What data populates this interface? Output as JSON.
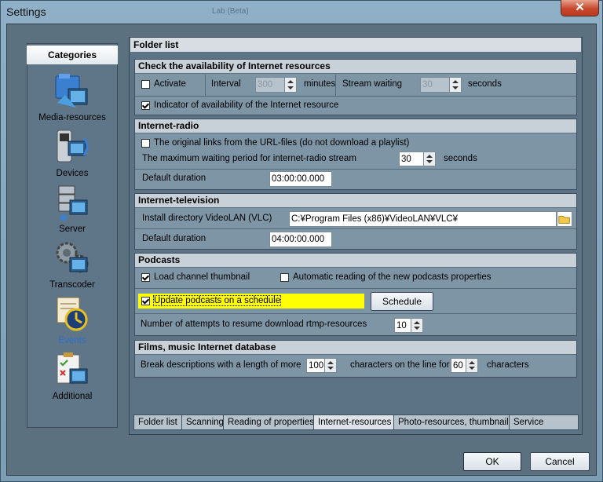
{
  "window": {
    "title": "Settings",
    "ghost_title": "Lab (Beta)",
    "close_glyph": "✕"
  },
  "categories": {
    "header": "Categories",
    "items": [
      {
        "label": "Media-resources",
        "icon": "media-resources-icon"
      },
      {
        "label": "Devices",
        "icon": "devices-icon"
      },
      {
        "label": "Server",
        "icon": "server-icon"
      },
      {
        "label": "Transcoder",
        "icon": "transcoder-icon"
      },
      {
        "label": "Events",
        "icon": "events-icon",
        "selected": true
      },
      {
        "label": "Additional",
        "icon": "additional-icon"
      }
    ]
  },
  "main": {
    "title": "Folder list"
  },
  "check_availability": {
    "title": "Check the availability of Internet resources",
    "activate_label": "Activate",
    "activate_checked": false,
    "interval_label": "Interval",
    "interval_value": "300",
    "interval_unit": "minutes",
    "stream_waiting_label": "Stream waiting",
    "stream_waiting_value": "30",
    "stream_waiting_unit": "seconds",
    "indicator_label": "Indicator of availability of the Internet resource",
    "indicator_checked": true
  },
  "internet_radio": {
    "title": "Internet-radio",
    "original_links_label": "The original links from the URL-files (do not download a playlist)",
    "original_links_checked": false,
    "max_wait_label": "The maximum waiting period for internet-radio stream",
    "max_wait_value": "30",
    "max_wait_unit": "seconds",
    "default_duration_label": "Default duration",
    "default_duration_value": "03:00:00.000"
  },
  "internet_tv": {
    "title": "Internet-television",
    "vlc_label": "Install directory VideoLAN (VLC)",
    "vlc_value": "C:¥Program Files (x86)¥VideoLAN¥VLC¥",
    "default_duration_label": "Default duration",
    "default_duration_value": "04:00:00.000"
  },
  "podcasts": {
    "title": "Podcasts",
    "load_thumbnail_label": "Load channel thumbnail",
    "load_thumbnail_checked": true,
    "auto_read_label": "Automatic reading of the new podcasts properties",
    "auto_read_checked": false,
    "update_schedule_label": "Update podcasts on a schedule",
    "update_schedule_checked": true,
    "schedule_button": "Schedule",
    "attempts_label": "Number of attempts to resume download rtmp-resources",
    "attempts_value": "10"
  },
  "films_db": {
    "title": "Films, music Internet database",
    "break_label": "Break descriptions with a length of more",
    "break_value": "100",
    "chars_line_label": "characters on the line for",
    "chars_line_value": "60",
    "chars_label": "characters"
  },
  "tabs": [
    "Folder list",
    "Scanning",
    "Reading of properties",
    "Internet-resources",
    "Photo-resources, thumbnails",
    "Service"
  ],
  "active_tab": "Internet-resources",
  "buttons": {
    "ok": "OK",
    "cancel": "Cancel"
  },
  "colors": {
    "highlight": "#ffff00",
    "selected_category": "#2e6dd1"
  }
}
